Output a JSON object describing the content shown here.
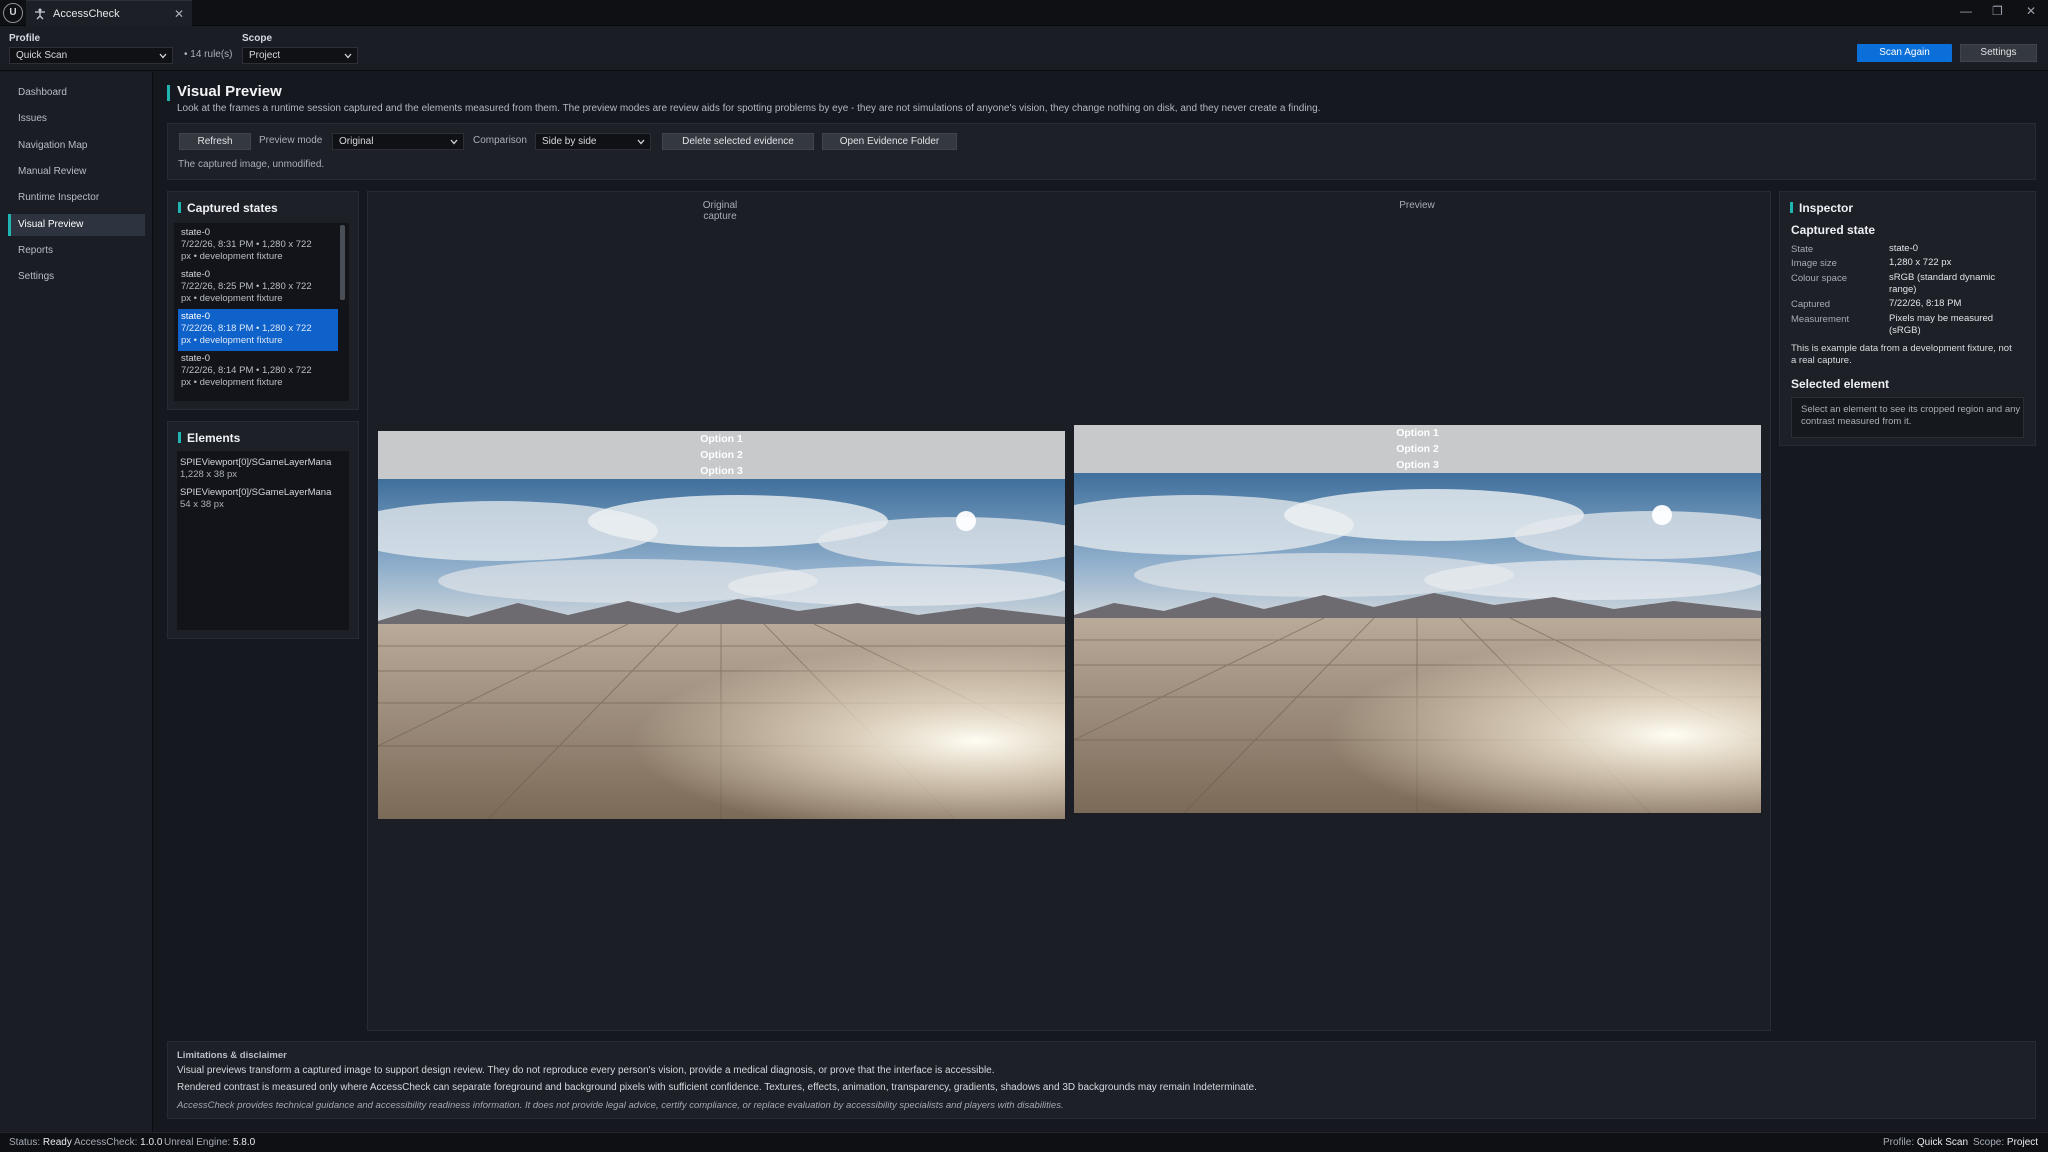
{
  "app": {
    "tab_title": "AccessCheck",
    "logo_text": "U"
  },
  "toolbar": {
    "profile_label": "Profile",
    "profile_value": "Quick Scan",
    "rule_count": "• 14 rule(s)",
    "scope_label": "Scope",
    "scope_value": "Project",
    "scan_again": "Scan Again",
    "settings": "Settings"
  },
  "sidebar": {
    "items": [
      {
        "label": "Dashboard"
      },
      {
        "label": "Issues"
      },
      {
        "label": "Navigation Map"
      },
      {
        "label": "Manual Review"
      },
      {
        "label": "Runtime Inspector"
      },
      {
        "label": "Visual Preview"
      },
      {
        "label": "Reports"
      },
      {
        "label": "Settings"
      }
    ],
    "active_index": 5
  },
  "page": {
    "title": "Visual Preview",
    "description": "Look at the frames a runtime session captured and the elements measured from them. The preview modes are review aids for spotting problems by eye - they are not simulations of anyone's vision, they change nothing on disk, and they never create a finding.",
    "controls": {
      "refresh": "Refresh",
      "preview_mode_label": "Preview mode",
      "preview_mode_value": "Original",
      "comparison_label": "Comparison",
      "comparison_value": "Side by side",
      "delete_evidence": "Delete selected evidence",
      "open_folder": "Open Evidence Folder"
    },
    "hint": "The captured image, unmodified."
  },
  "captured_states": {
    "title": "Captured states",
    "items": [
      {
        "name": "state-0",
        "meta1": "7/22/26, 8:31 PM  •  1,280 x 722",
        "meta2": "px  •  development fixture"
      },
      {
        "name": "state-0",
        "meta1": "7/22/26, 8:25 PM  •  1,280 x 722",
        "meta2": "px  •  development fixture"
      },
      {
        "name": "state-0",
        "meta1": "7/22/26, 8:18 PM  •  1,280 x 722",
        "meta2": "px  •  development fixture"
      },
      {
        "name": "state-0",
        "meta1": "7/22/26, 8:14 PM  •  1,280 x 722",
        "meta2": "px  •  development fixture"
      }
    ],
    "selected_index": 2
  },
  "elements": {
    "title": "Elements",
    "items": [
      {
        "name": "SPIEViewport[0]/SGameLayerMana",
        "size": "1,228 x 38 px"
      },
      {
        "name": "SPIEViewport[0]/SGameLayerMana",
        "size": "54 x 38 px"
      }
    ]
  },
  "preview": {
    "original_header_1": "Original",
    "original_header_2": "capture",
    "preview_header": "Preview",
    "options": [
      "Option 1",
      "Option 2",
      "Option 3"
    ]
  },
  "inspector": {
    "title": "Inspector",
    "captured_state_heading": "Captured state",
    "rows": [
      {
        "key": "State",
        "value": "state-0"
      },
      {
        "key": "Image size",
        "value": "1,280 x 722 px"
      },
      {
        "key": "Colour space",
        "value": "sRGB (standard dynamic range)"
      },
      {
        "key": "Captured",
        "value": "7/22/26, 8:18 PM"
      },
      {
        "key": "Measurement",
        "value": "Pixels may be measured (sRGB)"
      }
    ],
    "note": "This is example data from a development fixture, not a real capture.",
    "selected_element_heading": "Selected element",
    "selected_element_hint": "Select an element to see its cropped region and any contrast measured from it."
  },
  "disclaimer": {
    "title": "Limitations & disclaimer",
    "line1": "Visual previews transform a captured image to support design review. They do not reproduce every person's vision, provide a medical diagnosis, or prove that the interface is accessible.",
    "line2": "Rendered contrast is measured only where AccessCheck can separate foreground and background pixels with sufficient confidence. Textures, effects, animation, transparency, gradients, shadows and 3D backgrounds may remain Indeterminate.",
    "line3": "AccessCheck provides technical guidance and accessibility readiness information. It does not provide legal advice, certify compliance, or replace evaluation by accessibility specialists and players with disabilities."
  },
  "status": {
    "status_label": "Status:",
    "status_value": "Ready",
    "version_label": "AccessCheck:",
    "version_value": "1.0.0",
    "engine_label": "Unreal Engine:",
    "engine_value": "5.8.0",
    "profile_label": "Profile:",
    "profile_value": "Quick Scan",
    "scope_label": "Scope:",
    "scope_value": "Project"
  },
  "colors": {
    "accent": "#1fb5b0",
    "primary_button": "#0a6fd8",
    "selection": "#0f62c9"
  }
}
